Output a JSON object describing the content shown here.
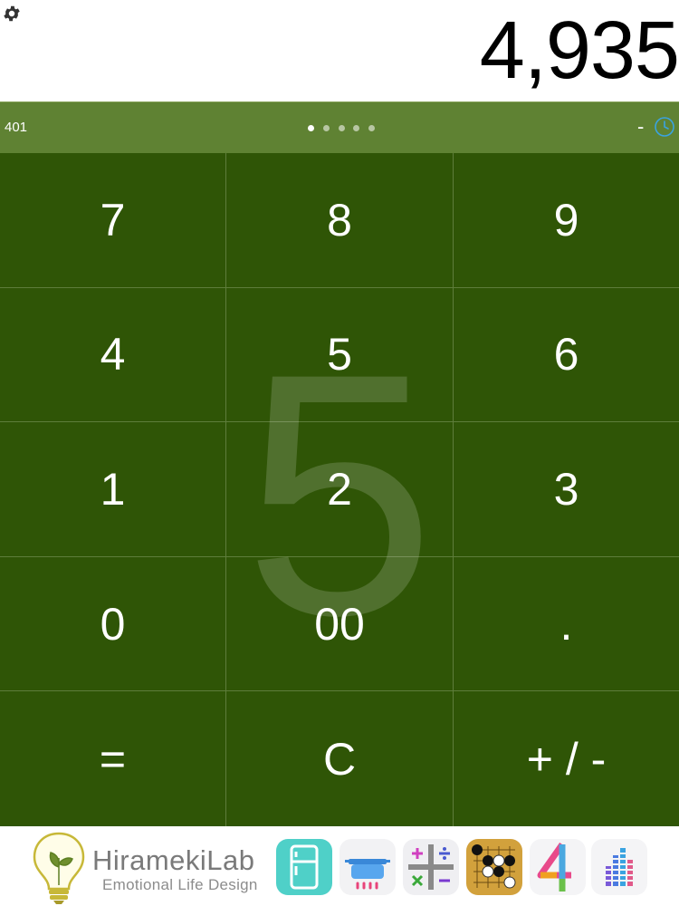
{
  "display": {
    "value": "4,935"
  },
  "strip": {
    "memory": "401",
    "operator": "-",
    "pages": 5,
    "active_page": 1
  },
  "keypad": {
    "keys": [
      "7",
      "8",
      "9",
      "4",
      "5",
      "6",
      "1",
      "2",
      "3",
      "0",
      "00",
      ".",
      "=",
      "C",
      "+ / -"
    ],
    "last_pressed": "5"
  },
  "ad": {
    "brand": "HiramekiLab",
    "tagline": "Emotional Life Design",
    "apps": [
      "fridge-app-icon",
      "pot-app-icon",
      "calculator-app-icon",
      "go-game-app-icon",
      "number-four-app-icon",
      "equalizer-app-icon"
    ]
  },
  "colors": {
    "keypad_bg": "#2f5506",
    "strip_bg": "#5f8233",
    "accent_blue": "#3aa3e0"
  }
}
